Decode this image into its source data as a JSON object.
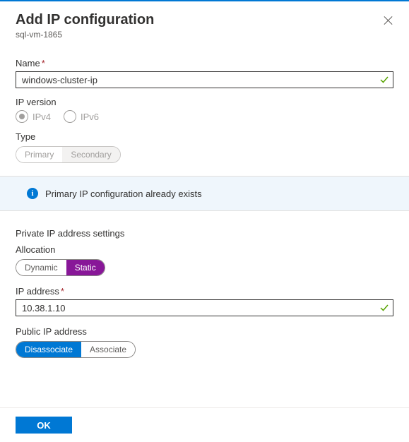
{
  "header": {
    "title": "Add IP configuration",
    "subtitle": "sql-vm-1865"
  },
  "fields": {
    "name": {
      "label": "Name",
      "required": "*",
      "value": "windows-cluster-ip"
    },
    "ip_version": {
      "label": "IP version",
      "options": {
        "ipv4": "IPv4",
        "ipv6": "IPv6"
      },
      "selected": "ipv4"
    },
    "type": {
      "label": "Type",
      "options": {
        "primary": "Primary",
        "secondary": "Secondary"
      }
    },
    "info_message": "Primary IP configuration already exists",
    "private_section": "Private IP address settings",
    "allocation": {
      "label": "Allocation",
      "options": {
        "dynamic": "Dynamic",
        "static": "Static"
      },
      "selected": "static"
    },
    "ip_address": {
      "label": "IP address",
      "required": "*",
      "value": "10.38.1.10"
    },
    "public_ip": {
      "label": "Public IP address",
      "options": {
        "disassociate": "Disassociate",
        "associate": "Associate"
      },
      "selected": "disassociate"
    }
  },
  "footer": {
    "ok": "OK"
  },
  "colors": {
    "accent_blue": "#0078d4",
    "accent_purple": "#881798",
    "required_red": "#a4262c",
    "info_bg": "#eff6fc",
    "valid_green": "#57a300"
  }
}
